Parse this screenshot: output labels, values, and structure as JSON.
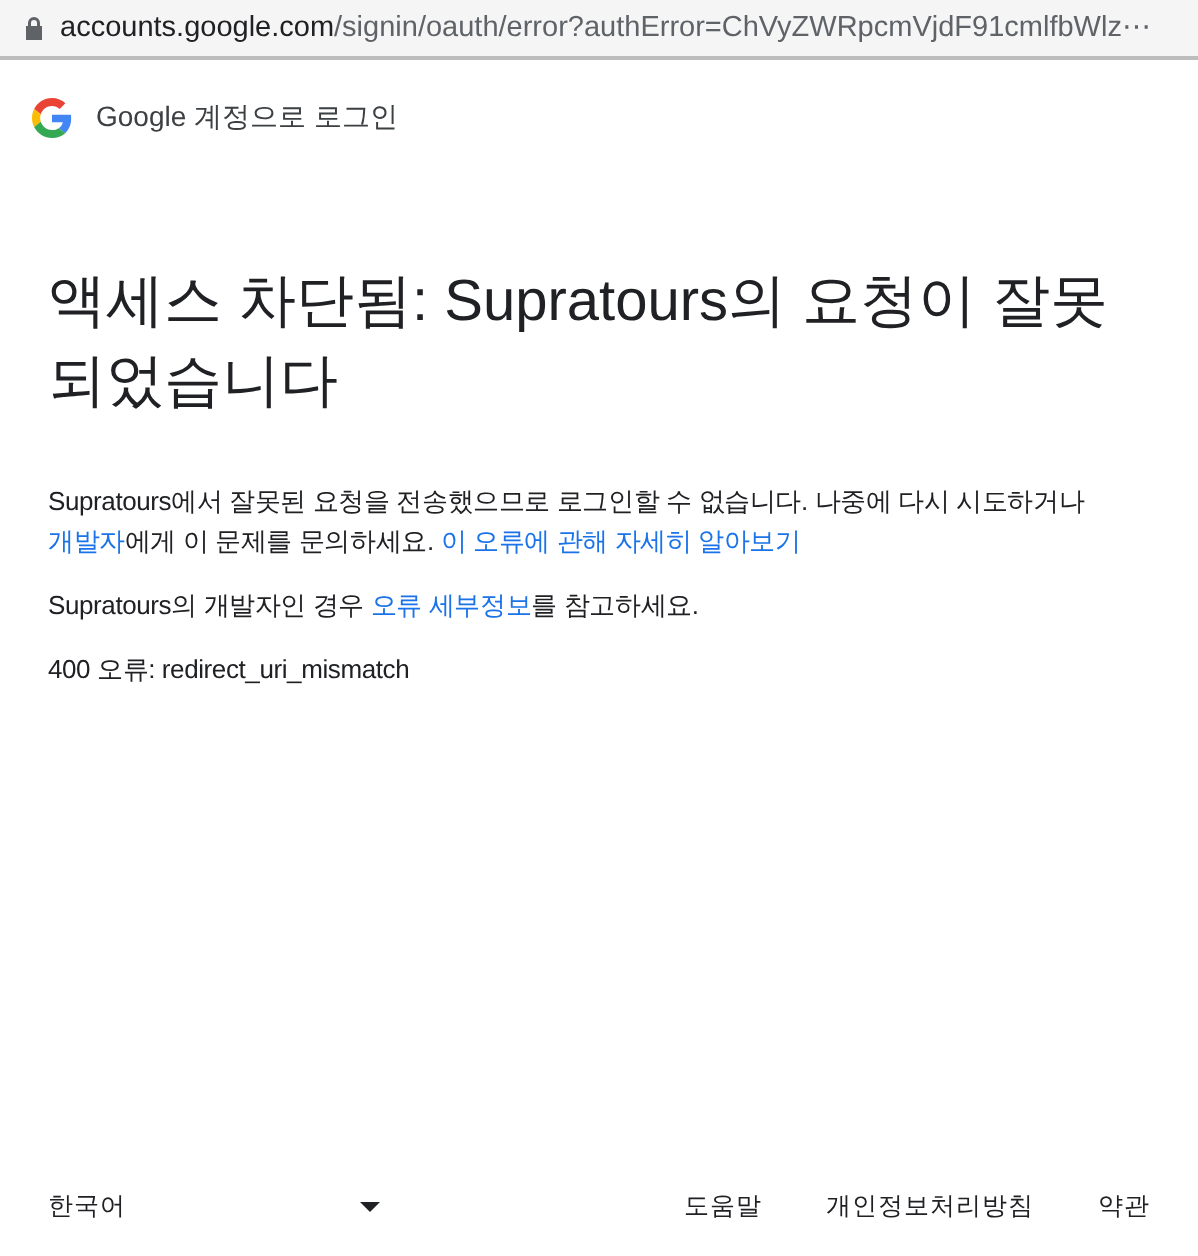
{
  "address_bar": {
    "host": "accounts.google.com",
    "path": "/signin/oauth/error?authError=ChVyZWRpcmVjdF91cmlfbWlz⋯"
  },
  "header": {
    "title": "Google 계정으로 로그인"
  },
  "heading": "액세스 차단됨: Supratours의 요청이 잘못되었습니다",
  "paragraphs": [
    [
      {
        "text": "Supratours에서 잘못된 요청을 전송했으므로 로그인할 수 없습니다. 나중에 다시 시도하거나 ",
        "link": false
      },
      {
        "text": "개발자",
        "link": true
      },
      {
        "text": "에게 이 문제를 문의하세요. ",
        "link": false
      },
      {
        "text": "이 오류에 관해 자세히 알아보기",
        "link": true
      }
    ],
    [
      {
        "text": "Supratours의 개발자인 경우 ",
        "link": false
      },
      {
        "text": "오류 세부정보",
        "link": true
      },
      {
        "text": "를 참고하세요.",
        "link": false
      }
    ],
    [
      {
        "text": "400 오류: redirect_uri_mismatch",
        "link": false
      }
    ]
  ],
  "footer": {
    "language": "한국어",
    "links": [
      "도움말",
      "개인정보처리방침",
      "약관"
    ]
  }
}
